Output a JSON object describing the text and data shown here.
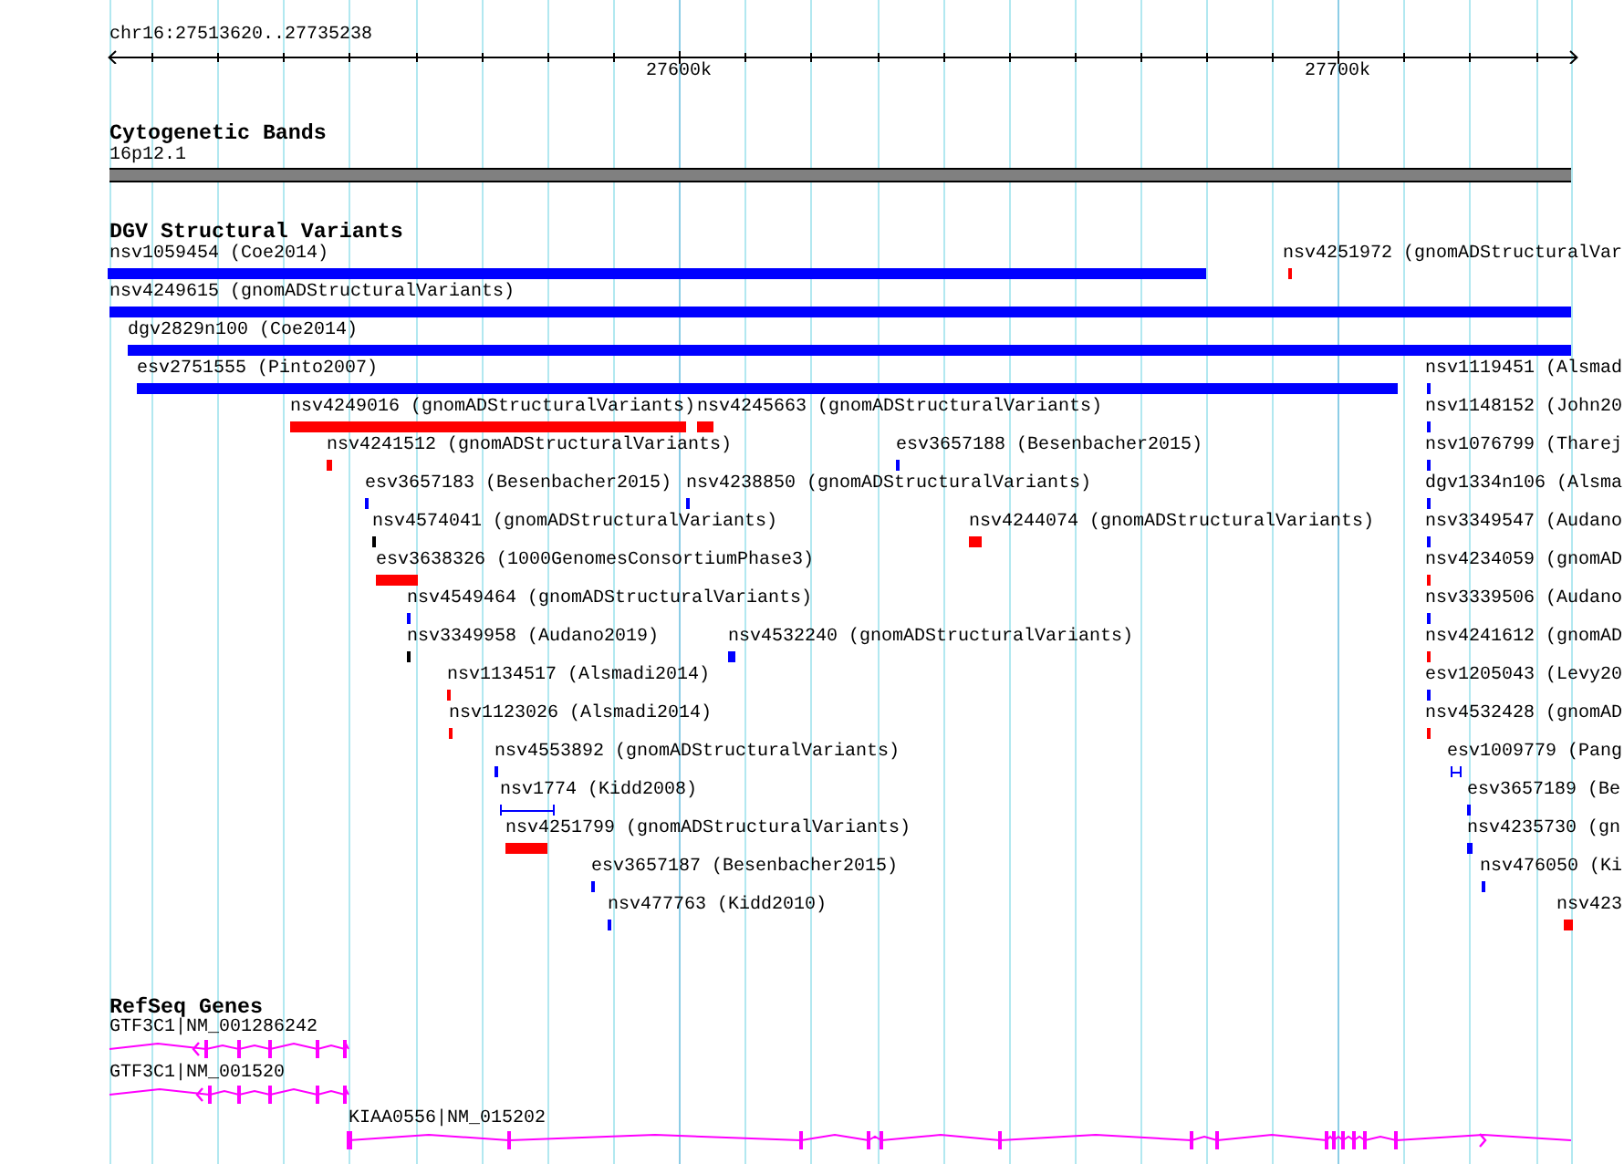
{
  "ruler": {
    "location": "chr16:27513620..27735238",
    "ticks": [
      "27600k",
      "27700k"
    ]
  },
  "cytogenetic_bands": {
    "title": "Cytogenetic Bands",
    "bands": [
      {
        "label": "16p12.1"
      }
    ]
  },
  "dgv_structural_variants": {
    "title": "DGV Structural Variants",
    "rows": [
      {
        "features": [
          {
            "label": "nsv1059454 (Coe2014)",
            "color": "#0000ff",
            "kind": "block"
          },
          {
            "label": "nsv4251972 (gnomADStructuralVar",
            "color": "#ff0000",
            "kind": "block"
          }
        ]
      },
      {
        "features": [
          {
            "label": "nsv4249615 (gnomADStructuralVariants)",
            "color": "#0000ff",
            "kind": "block"
          }
        ]
      },
      {
        "features": [
          {
            "label": "dgv2829n100 (Coe2014)",
            "color": "#0000ff",
            "kind": "block"
          }
        ]
      },
      {
        "features": [
          {
            "label": "esv2751555 (Pinto2007)",
            "color": "#0000ff",
            "kind": "block"
          },
          {
            "label": "nsv1119451 (Alsmad",
            "color": "#0000ff",
            "kind": "block"
          }
        ]
      },
      {
        "features": [
          {
            "label": "nsv4249016 (gnomADStructuralVariants)",
            "color": "#ff0000",
            "kind": "block"
          },
          {
            "label": "nsv4245663 (gnomADStructuralVariants)",
            "color": "#ff0000",
            "kind": "block"
          },
          {
            "label": "nsv1148152 (John20",
            "color": "#0000ff",
            "kind": "block"
          }
        ]
      },
      {
        "features": [
          {
            "label": "nsv4241512 (gnomADStructuralVariants)",
            "color": "#ff0000",
            "kind": "block"
          },
          {
            "label": "esv3657188 (Besenbacher2015)",
            "color": "#0000ff",
            "kind": "block"
          },
          {
            "label": "nsv1076799 (Tharej",
            "color": "#0000ff",
            "kind": "block"
          }
        ]
      },
      {
        "features": [
          {
            "label": "esv3657183 (Besenbacher2015)",
            "color": "#0000ff",
            "kind": "block"
          },
          {
            "label": "nsv4238850 (gnomADStructuralVariants)",
            "color": "#0000ff",
            "kind": "block"
          },
          {
            "label": "dgv1334n106 (Alsma",
            "color": "#0000ff",
            "kind": "block"
          }
        ]
      },
      {
        "features": [
          {
            "label": "nsv4574041 (gnomADStructuralVariants)",
            "color": "#000000",
            "kind": "block"
          },
          {
            "label": "nsv4244074 (gnomADStructuralVariants)",
            "color": "#ff0000",
            "kind": "block"
          },
          {
            "label": "nsv3349547 (Audano",
            "color": "#0000ff",
            "kind": "block"
          }
        ]
      },
      {
        "features": [
          {
            "label": "esv3638326 (1000GenomesConsortiumPhase3)",
            "color": "#ff0000",
            "kind": "block"
          },
          {
            "label": "nsv4234059 (gnomAD",
            "color": "#ff0000",
            "kind": "block"
          }
        ]
      },
      {
        "features": [
          {
            "label": "nsv4549464 (gnomADStructuralVariants)",
            "color": "#0000ff",
            "kind": "block"
          },
          {
            "label": "nsv3339506 (Audano",
            "color": "#0000ff",
            "kind": "block"
          }
        ]
      },
      {
        "features": [
          {
            "label": "nsv3349958 (Audano2019)",
            "color": "#000000",
            "kind": "block"
          },
          {
            "label": "nsv4532240 (gnomADStructuralVariants)",
            "color": "#0000ff",
            "kind": "block"
          },
          {
            "label": "nsv4241612 (gnomAD",
            "color": "#ff0000",
            "kind": "block"
          }
        ]
      },
      {
        "features": [
          {
            "label": "nsv1134517 (Alsmadi2014)",
            "color": "#ff0000",
            "kind": "block"
          },
          {
            "label": "esv1205043 (Levy20",
            "color": "#0000ff",
            "kind": "block"
          }
        ]
      },
      {
        "features": [
          {
            "label": "nsv1123026 (Alsmadi2014)",
            "color": "#ff0000",
            "kind": "block"
          },
          {
            "label": "nsv4532428 (gnomAD",
            "color": "#ff0000",
            "kind": "block"
          }
        ]
      },
      {
        "features": [
          {
            "label": "nsv4553892 (gnomADStructuralVariants)",
            "color": "#0000ff",
            "kind": "block"
          },
          {
            "label": "esv1009779 (Pang",
            "color": "#0000ff",
            "kind": "span"
          }
        ]
      },
      {
        "features": [
          {
            "label": "nsv1774 (Kidd2008)",
            "color": "#0000ff",
            "kind": "span"
          },
          {
            "label": "esv3657189 (Be",
            "color": "#0000ff",
            "kind": "block"
          }
        ]
      },
      {
        "features": [
          {
            "label": "nsv4251799 (gnomADStructuralVariants)",
            "color": "#ff0000",
            "kind": "block"
          },
          {
            "label": "nsv4235730 (gn",
            "color": "#0000ff",
            "kind": "block"
          }
        ]
      },
      {
        "features": [
          {
            "label": "esv3657187 (Besenbacher2015)",
            "color": "#0000ff",
            "kind": "block"
          },
          {
            "label": "nsv476050 (Ki",
            "color": "#0000ff",
            "kind": "block"
          }
        ]
      },
      {
        "features": [
          {
            "label": "nsv477763 (Kidd2010)",
            "color": "#0000ff",
            "kind": "block"
          },
          {
            "label": "nsv423",
            "color": "#ff0000",
            "kind": "block"
          }
        ]
      }
    ]
  },
  "refseq_genes": {
    "title": "RefSeq Genes",
    "genes": [
      {
        "label": "GTF3C1|NM_001286242",
        "reverse_strand": true
      },
      {
        "label": "GTF3C1|NM_001520",
        "reverse_strand": true
      },
      {
        "label": "KIAA0556|NM_015202",
        "reverse_strand": false
      }
    ]
  }
}
